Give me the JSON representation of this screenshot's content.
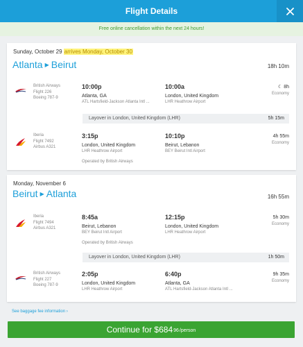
{
  "header": {
    "title": "Flight Details",
    "close_icon": "close-icon"
  },
  "banner": {
    "text": "Free online cancellation within the next 24 hours!"
  },
  "outbound": {
    "date": "Sunday, October 29",
    "arrives_note": "arrives Monday, October 30",
    "origin": "Atlanta",
    "destination": "Beirut",
    "total_duration": "18h 10m",
    "segments": [
      {
        "airline": "British Airways",
        "flight": "Flight 226",
        "aircraft": "Boeing 787-9",
        "dep_time": "10:00p",
        "dep_city": "Atlanta, GA",
        "dep_airport": "ATL Hartsfield-Jackson Atlanta Intl ...",
        "arr_time": "10:00a",
        "arr_city": "London, United Kingdom",
        "arr_airport": "LHR Heathrow Airport",
        "duration": "8h",
        "cabin": "Economy",
        "operated_by": ""
      },
      {
        "airline": "Iberia",
        "flight": "Flight 7492",
        "aircraft": "Airbus A321",
        "dep_time": "3:15p",
        "dep_city": "London, United Kingdom",
        "dep_airport": "LHR Heathrow Airport",
        "arr_time": "10:10p",
        "arr_city": "Beirut, Lebanon",
        "arr_airport": "BEY Beirut Intl Airport",
        "duration": "4h 55m",
        "cabin": "Economy",
        "operated_by": "Operated by British Airways"
      }
    ],
    "layover": {
      "label": "Layover in London, United Kingdom (LHR)",
      "duration": "5h 15m"
    }
  },
  "return": {
    "date": "Monday, November 6",
    "origin": "Beirut",
    "destination": "Atlanta",
    "total_duration": "16h 55m",
    "segments": [
      {
        "airline": "Iberia",
        "flight": "Flight 7494",
        "aircraft": "Airbus A321",
        "dep_time": "8:45a",
        "dep_city": "Beirut, Lebanon",
        "dep_airport": "BEY Beirut Intl Airport",
        "arr_time": "12:15p",
        "arr_city": "London, United Kingdom",
        "arr_airport": "LHR Heathrow Airport",
        "duration": "5h 30m",
        "cabin": "Economy",
        "operated_by": "Operated by British Airways"
      },
      {
        "airline": "British Airways",
        "flight": "Flight 227",
        "aircraft": "Boeing 787-9",
        "dep_time": "2:05p",
        "dep_city": "London, United Kingdom",
        "dep_airport": "LHR Heathrow Airport",
        "arr_time": "6:40p",
        "arr_city": "Atlanta, GA",
        "arr_airport": "ATL Hartsfield-Jackson Atlanta Intl ...",
        "duration": "9h 35m",
        "cabin": "Economy",
        "operated_by": ""
      }
    ],
    "layover": {
      "label": "Layover in London, United Kingdom (LHR)",
      "duration": "1h 50m"
    }
  },
  "baggage_link": "See baggage fee information",
  "continue": {
    "label": "Continue for $684",
    "cents": "96",
    "per": "/person"
  },
  "colors": {
    "brand_blue": "#1c9fd9",
    "continue_green": "#3aa432",
    "banner_green": "#3e9b2c",
    "highlight": "#fff37a"
  }
}
